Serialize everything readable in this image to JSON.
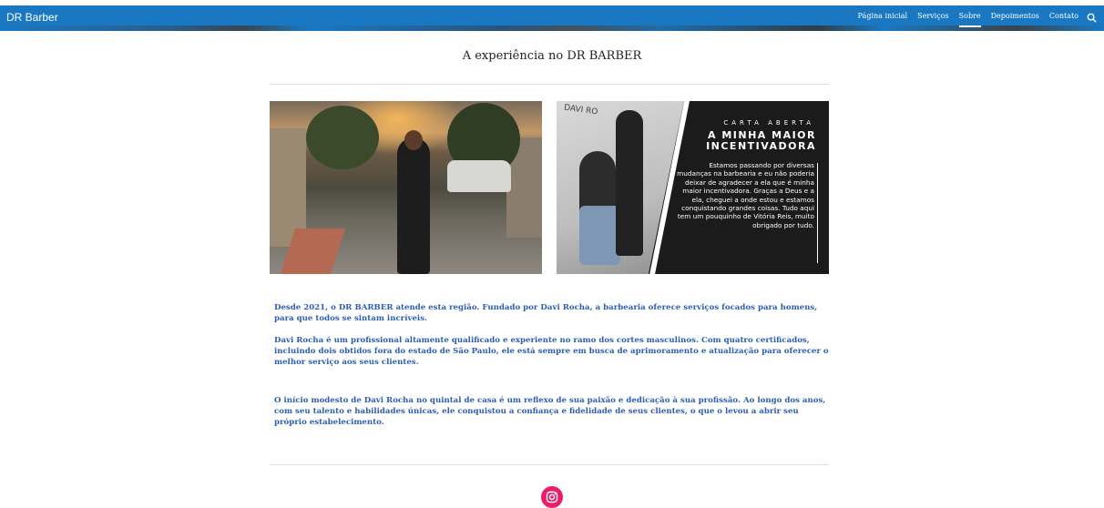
{
  "header": {
    "brand": "DR Barber",
    "nav": [
      "Página inicial",
      "Serviços",
      "Sobre",
      "Depoimentos",
      "Contato"
    ],
    "active_item": "Sobre",
    "search_icon": "search-icon",
    "bar_color": "#1a78c2"
  },
  "main": {
    "title": "A experiência no DR BARBER",
    "card": {
      "watermark": "DAVI RO",
      "kicker": "CARTA ABERTA",
      "title": "A MINHA MAIOR INCENTIVADORA",
      "body": "Estamos passando por diversas mudanças na barbearia e eu não poderia deixar de agradecer a ela que é minha maior incentivadora. Graças a Deus e a ela, cheguei a onde estou e estamos conquistando grandes coisas. Tudo aqui tem um pouquinho de Vitória Reis, muito obrigado por tudo."
    },
    "paragraphs": [
      "Desde 2021, o DR BARBER atende esta região. Fundado por Davi Rocha, a barbearia oferece serviços focados para homens, para que todos se sintam incríveis.",
      "Davi Rocha é um profissional altamente qualificado e experiente no ramo dos cortes masculinos. Com quatro certificados, incluindo dois obtidos fora do estado de São Paulo, ele está sempre em busca de aprimoramento e atualização para oferecer o melhor serviço aos seus clientes.",
      "O início modesto de Davi Rocha no quintal de casa é um reflexo de sua paixão e dedicação à sua profissão. Ao longo dos anos, com seu talento e habilidades únicas, ele conquistou a confiança e fidelidade de seus clientes, o que o levou a abrir seu próprio estabelecimento."
    ],
    "text_color": "#2c5fb0"
  },
  "footer": {
    "social_icon": "instagram-icon",
    "social_color": "#e81f6b"
  }
}
